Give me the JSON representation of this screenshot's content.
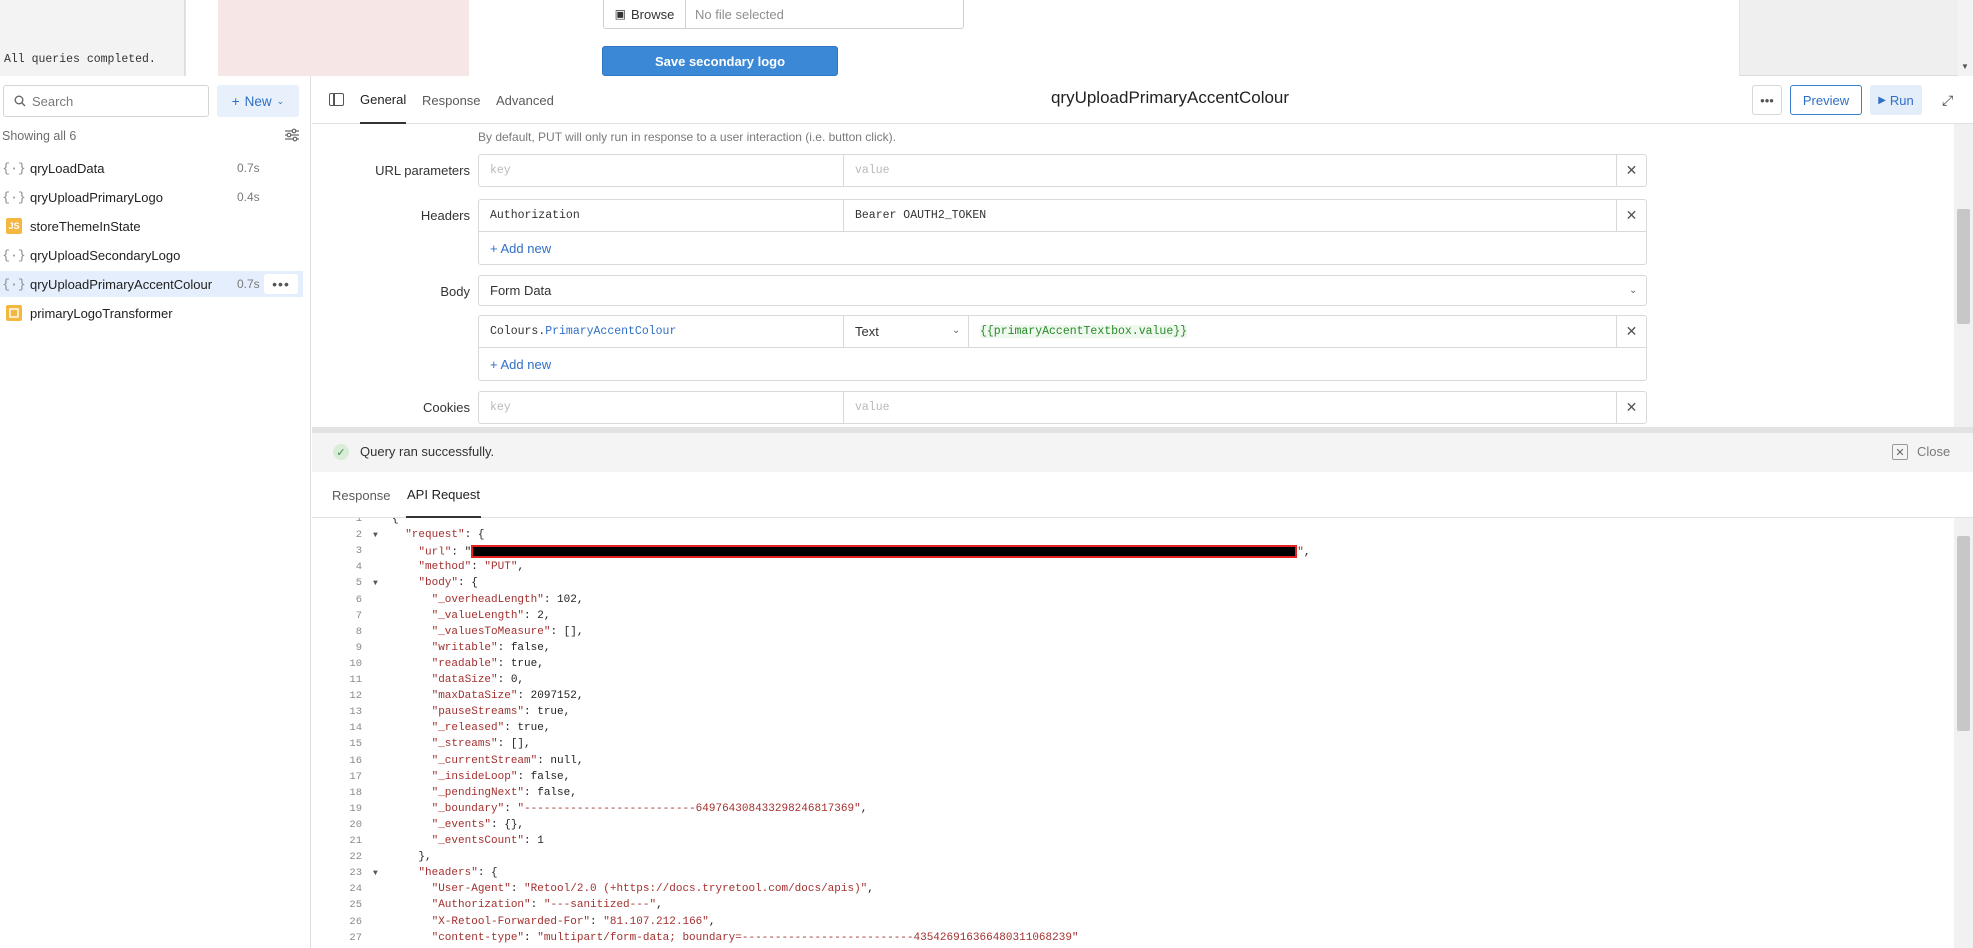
{
  "canvas": {
    "status_text": "All queries completed.",
    "browse_label": "Browse",
    "file_placeholder": "No file selected",
    "save_button": "Save secondary logo"
  },
  "sidebar": {
    "search_placeholder": "Search",
    "new_label": "New",
    "showing_label": "Showing all 6",
    "queries": [
      {
        "name": "qryLoadData",
        "time": "0.7s",
        "icon": "api-icon"
      },
      {
        "name": "qryUploadPrimaryLogo",
        "time": "0.4s",
        "icon": "api-icon"
      },
      {
        "name": "storeThemeInState",
        "time": "",
        "icon": "js-icon"
      },
      {
        "name": "qryUploadSecondaryLogo",
        "time": "",
        "icon": "api-icon"
      },
      {
        "name": "qryUploadPrimaryAccentColour",
        "time": "0.7s",
        "icon": "api-icon",
        "selected": true
      },
      {
        "name": "primaryLogoTransformer",
        "time": "",
        "icon": "transformer-icon"
      }
    ],
    "js_badge": "JS"
  },
  "editor": {
    "tabs": [
      "General",
      "Response",
      "Advanced"
    ],
    "active_tab": "General",
    "title": "qryUploadPrimaryAccentColour",
    "preview_label": "Preview",
    "run_label": "Run",
    "hint": "By default, PUT will only run in response to a user interaction (i.e. button click).",
    "url_params_label": "URL parameters",
    "url_params_key_ph": "key",
    "url_params_value_ph": "value",
    "headers_label": "Headers",
    "header_key": "Authorization",
    "header_value": "Bearer OAUTH2_TOKEN",
    "add_new": "+ Add new",
    "body_label": "Body",
    "body_type": "Form Data",
    "body_key_prefix": "Colours.",
    "body_key_suffix": "PrimaryAccentColour",
    "body_value_type": "Text",
    "body_value": "{{primaryAccentTextbox.value}}",
    "cookies_label": "Cookies",
    "cookies_key_ph": "key",
    "cookies_value_ph": "value"
  },
  "results": {
    "status": "Query ran successfully.",
    "close_label": "Close",
    "tabs": [
      "Response",
      "API Request"
    ],
    "active_tab": "API Request",
    "lines": [
      {
        "n": "1",
        "t": "{"
      },
      {
        "n": "2",
        "t": "  \"request\": {"
      },
      {
        "n": "3",
        "t": "    \"url\": \""
      },
      {
        "n": "4",
        "t": "    \"method\": \"PUT\","
      },
      {
        "n": "5",
        "t": "    \"body\": {"
      },
      {
        "n": "6",
        "t": "      \"_overheadLength\": 102,"
      },
      {
        "n": "7",
        "t": "      \"_valueLength\": 2,"
      },
      {
        "n": "8",
        "t": "      \"_valuesToMeasure\": [],"
      },
      {
        "n": "9",
        "t": "      \"writable\": false,"
      },
      {
        "n": "10",
        "t": "      \"readable\": true,"
      },
      {
        "n": "11",
        "t": "      \"dataSize\": 0,"
      },
      {
        "n": "12",
        "t": "      \"maxDataSize\": 2097152,"
      },
      {
        "n": "13",
        "t": "      \"pauseStreams\": true,"
      },
      {
        "n": "14",
        "t": "      \"_released\": true,"
      },
      {
        "n": "15",
        "t": "      \"_streams\": [],"
      },
      {
        "n": "16",
        "t": "      \"_currentStream\": null,"
      },
      {
        "n": "17",
        "t": "      \"_insideLoop\": false,"
      },
      {
        "n": "18",
        "t": "      \"_pendingNext\": false,"
      },
      {
        "n": "19",
        "t": "      \"_boundary\": \"--------------------------649764308433298246817369\","
      },
      {
        "n": "20",
        "t": "      \"_events\": {},"
      },
      {
        "n": "21",
        "t": "      \"_eventsCount\": 1"
      },
      {
        "n": "22",
        "t": "    },"
      },
      {
        "n": "23",
        "t": "    \"headers\": {"
      },
      {
        "n": "24",
        "t": "      \"User-Agent\": \"Retool/2.0 (+https://docs.tryretool.com/docs/apis)\","
      },
      {
        "n": "25",
        "t": "      \"Authorization\": \"---sanitized---\","
      },
      {
        "n": "26",
        "t": "      \"X-Retool-Forwarded-For\": \"81.107.212.166\","
      },
      {
        "n": "27",
        "t": "      \"content-type\": \"multipart/form-data; boundary=--------------------------435426916366480311068239\""
      }
    ]
  },
  "colors": {
    "accent": "#2f6fc6",
    "save_button_bg": "#3a88d6",
    "selected_row": "#e5eefc",
    "string_red": "#a3302f",
    "success_green": "#3c8a3c"
  }
}
